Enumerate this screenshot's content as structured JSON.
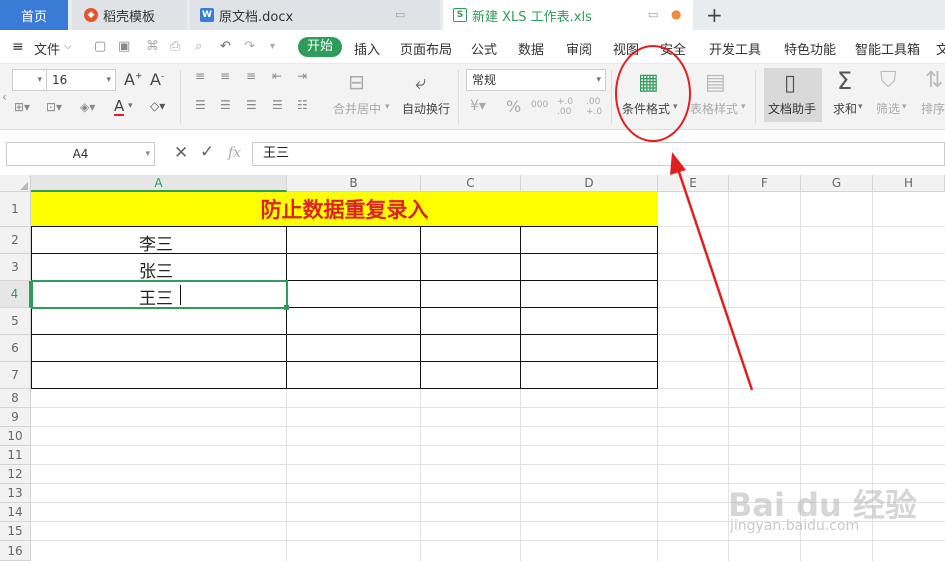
{
  "tabs": {
    "home": "首页",
    "template": "稻壳模板",
    "document": "原文档.docx",
    "workbook": "新建 XLS 工作表.xls",
    "new_tab": "+"
  },
  "menu": {
    "file": "文件",
    "start": "开始",
    "insert": "插入",
    "page_layout": "页面布局",
    "formula": "公式",
    "data": "数据",
    "review": "审阅",
    "view": "视图",
    "security": "安全",
    "developer": "开发工具",
    "special": "特色功能",
    "smart_toolbox": "智能工具箱",
    "more": "文"
  },
  "ribbon": {
    "font_size": "16",
    "number_format": "常规",
    "merge_center": "合并居中",
    "wrap_text": "自动换行",
    "conditional_format": "条件格式",
    "table_style": "表格样式",
    "doc_assistant": "文档助手",
    "sum": "求和",
    "filter": "筛选",
    "sort": "排序",
    "percent": "%",
    "thousands": "000",
    "inc_decimal": "+.0 .00",
    "dec_decimal": ".00 +.0"
  },
  "formula_bar": {
    "name_box": "A4",
    "fx": "fx",
    "content": "王三"
  },
  "sheet": {
    "columns": [
      "A",
      "B",
      "C",
      "D",
      "E",
      "F",
      "G",
      "H"
    ],
    "rows": [
      "1",
      "2",
      "3",
      "4",
      "5",
      "6",
      "7",
      "8",
      "9",
      "10",
      "11",
      "12",
      "13",
      "14",
      "15",
      "16"
    ],
    "title": "防止数据重复录入",
    "names": [
      "李三",
      "张三",
      "王三"
    ],
    "active_cell": "A4"
  },
  "watermark": {
    "main": "Bai du 经验",
    "sub": "jingyan.baidu.com"
  },
  "colors": {
    "accent": "#2e9c5a",
    "tab_home": "#3a7bd5",
    "title_fill": "#ffff00",
    "title_text": "#dd2222",
    "annotation": "#e02020"
  }
}
